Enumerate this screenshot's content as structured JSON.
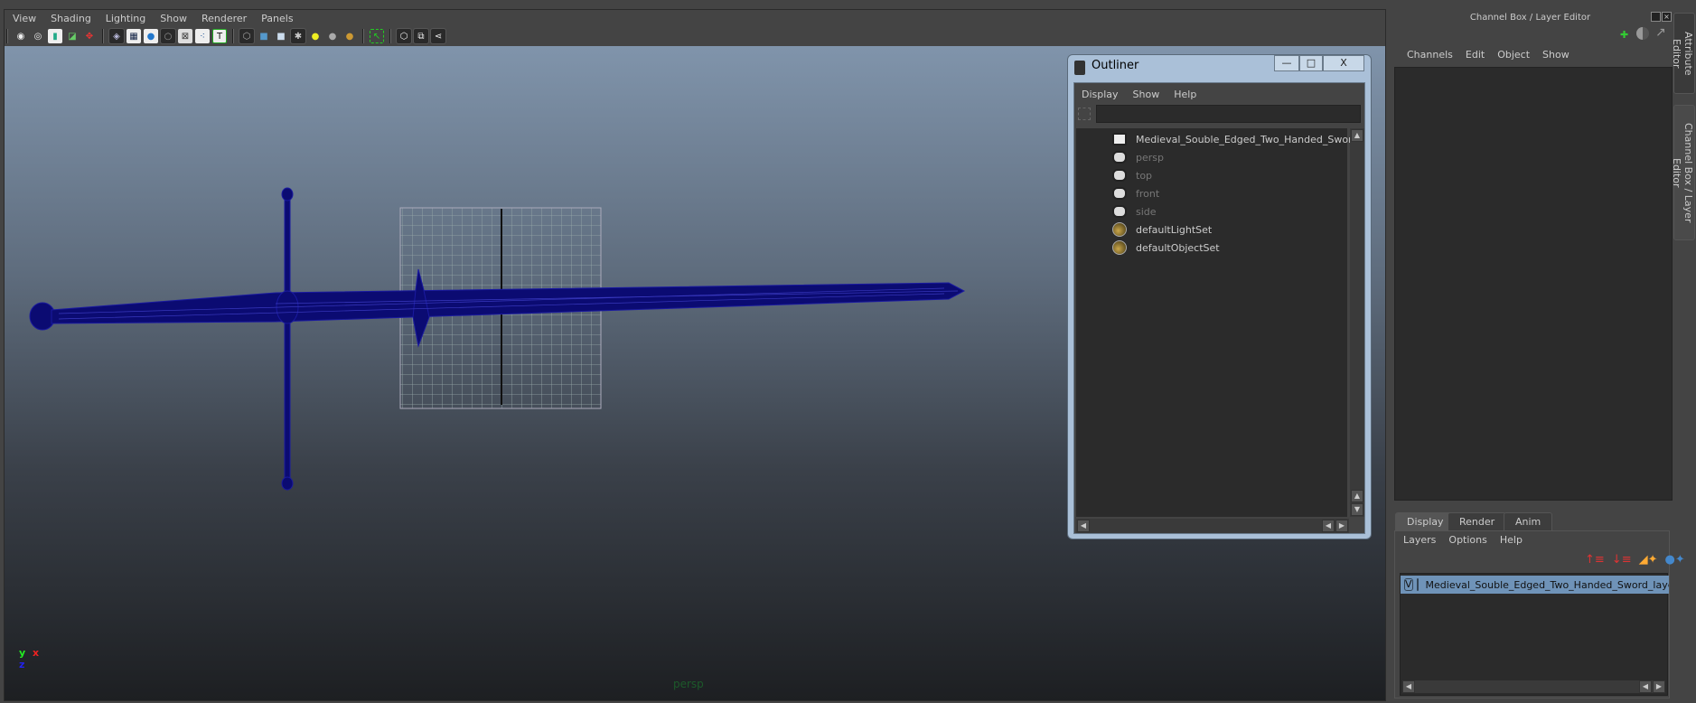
{
  "viewport": {
    "menu": [
      "View",
      "Shading",
      "Lighting",
      "Show",
      "Renderer",
      "Panels"
    ],
    "toolbar_icons": [
      "select-camera-icon",
      "camera-attributes-icon",
      "bookmarks-icon",
      "image-plane-icon",
      "2d-pan-zoom-icon",
      "grid-icon",
      "film-gate-icon",
      "smooth-shade-icon",
      "wireframe-on-shaded-icon",
      "xray-icon",
      "xray-joints-icon",
      "textured-icon",
      "wireframe-icon",
      "smooth-shade-all-icon",
      "default-material-icon",
      "shadows-icon",
      "use-all-lights-icon",
      "default-lighting-icon",
      "high-quality-icon",
      "isolate-select-icon",
      "ambient-occlusion-icon",
      "motion-blur-icon",
      "multisample-icon"
    ],
    "camera_label": "persp",
    "axis": {
      "x": "x",
      "y": "y",
      "z": "z"
    }
  },
  "outliner": {
    "title": "Outliner",
    "menu": [
      "Display",
      "Show",
      "Help"
    ],
    "search_value": "",
    "items": [
      {
        "label": "Medieval_Souble_Edged_Two_Handed_Sword",
        "icon": "mesh-icon",
        "dim": false
      },
      {
        "label": "persp",
        "icon": "camera-icon",
        "dim": true
      },
      {
        "label": "top",
        "icon": "camera-icon",
        "dim": true
      },
      {
        "label": "front",
        "icon": "camera-icon",
        "dim": true
      },
      {
        "label": "side",
        "icon": "camera-icon",
        "dim": true
      },
      {
        "label": "defaultLightSet",
        "icon": "set-icon",
        "dim": false
      },
      {
        "label": "defaultObjectSet",
        "icon": "set-icon",
        "dim": false
      }
    ],
    "win_buttons": {
      "minimize": "—",
      "maximize": "□",
      "close": "X"
    }
  },
  "channel_box": {
    "title": "Channel Box / Layer Editor",
    "menu": [
      "Channels",
      "Edit",
      "Object",
      "Show"
    ],
    "side_tabs": [
      "Attribute Editor",
      "Channel Box / Layer Editor"
    ]
  },
  "layer_editor": {
    "tabs": [
      "Display",
      "Render",
      "Anim"
    ],
    "active_tab": "Display",
    "menu": [
      "Layers",
      "Options",
      "Help"
    ],
    "layers": [
      {
        "visible": "V",
        "name": "Medieval_Souble_Edged_Two_Handed_Sword_layer"
      }
    ]
  },
  "colors": {
    "accent": "#6f93b8",
    "sword": "#0a0a78"
  }
}
